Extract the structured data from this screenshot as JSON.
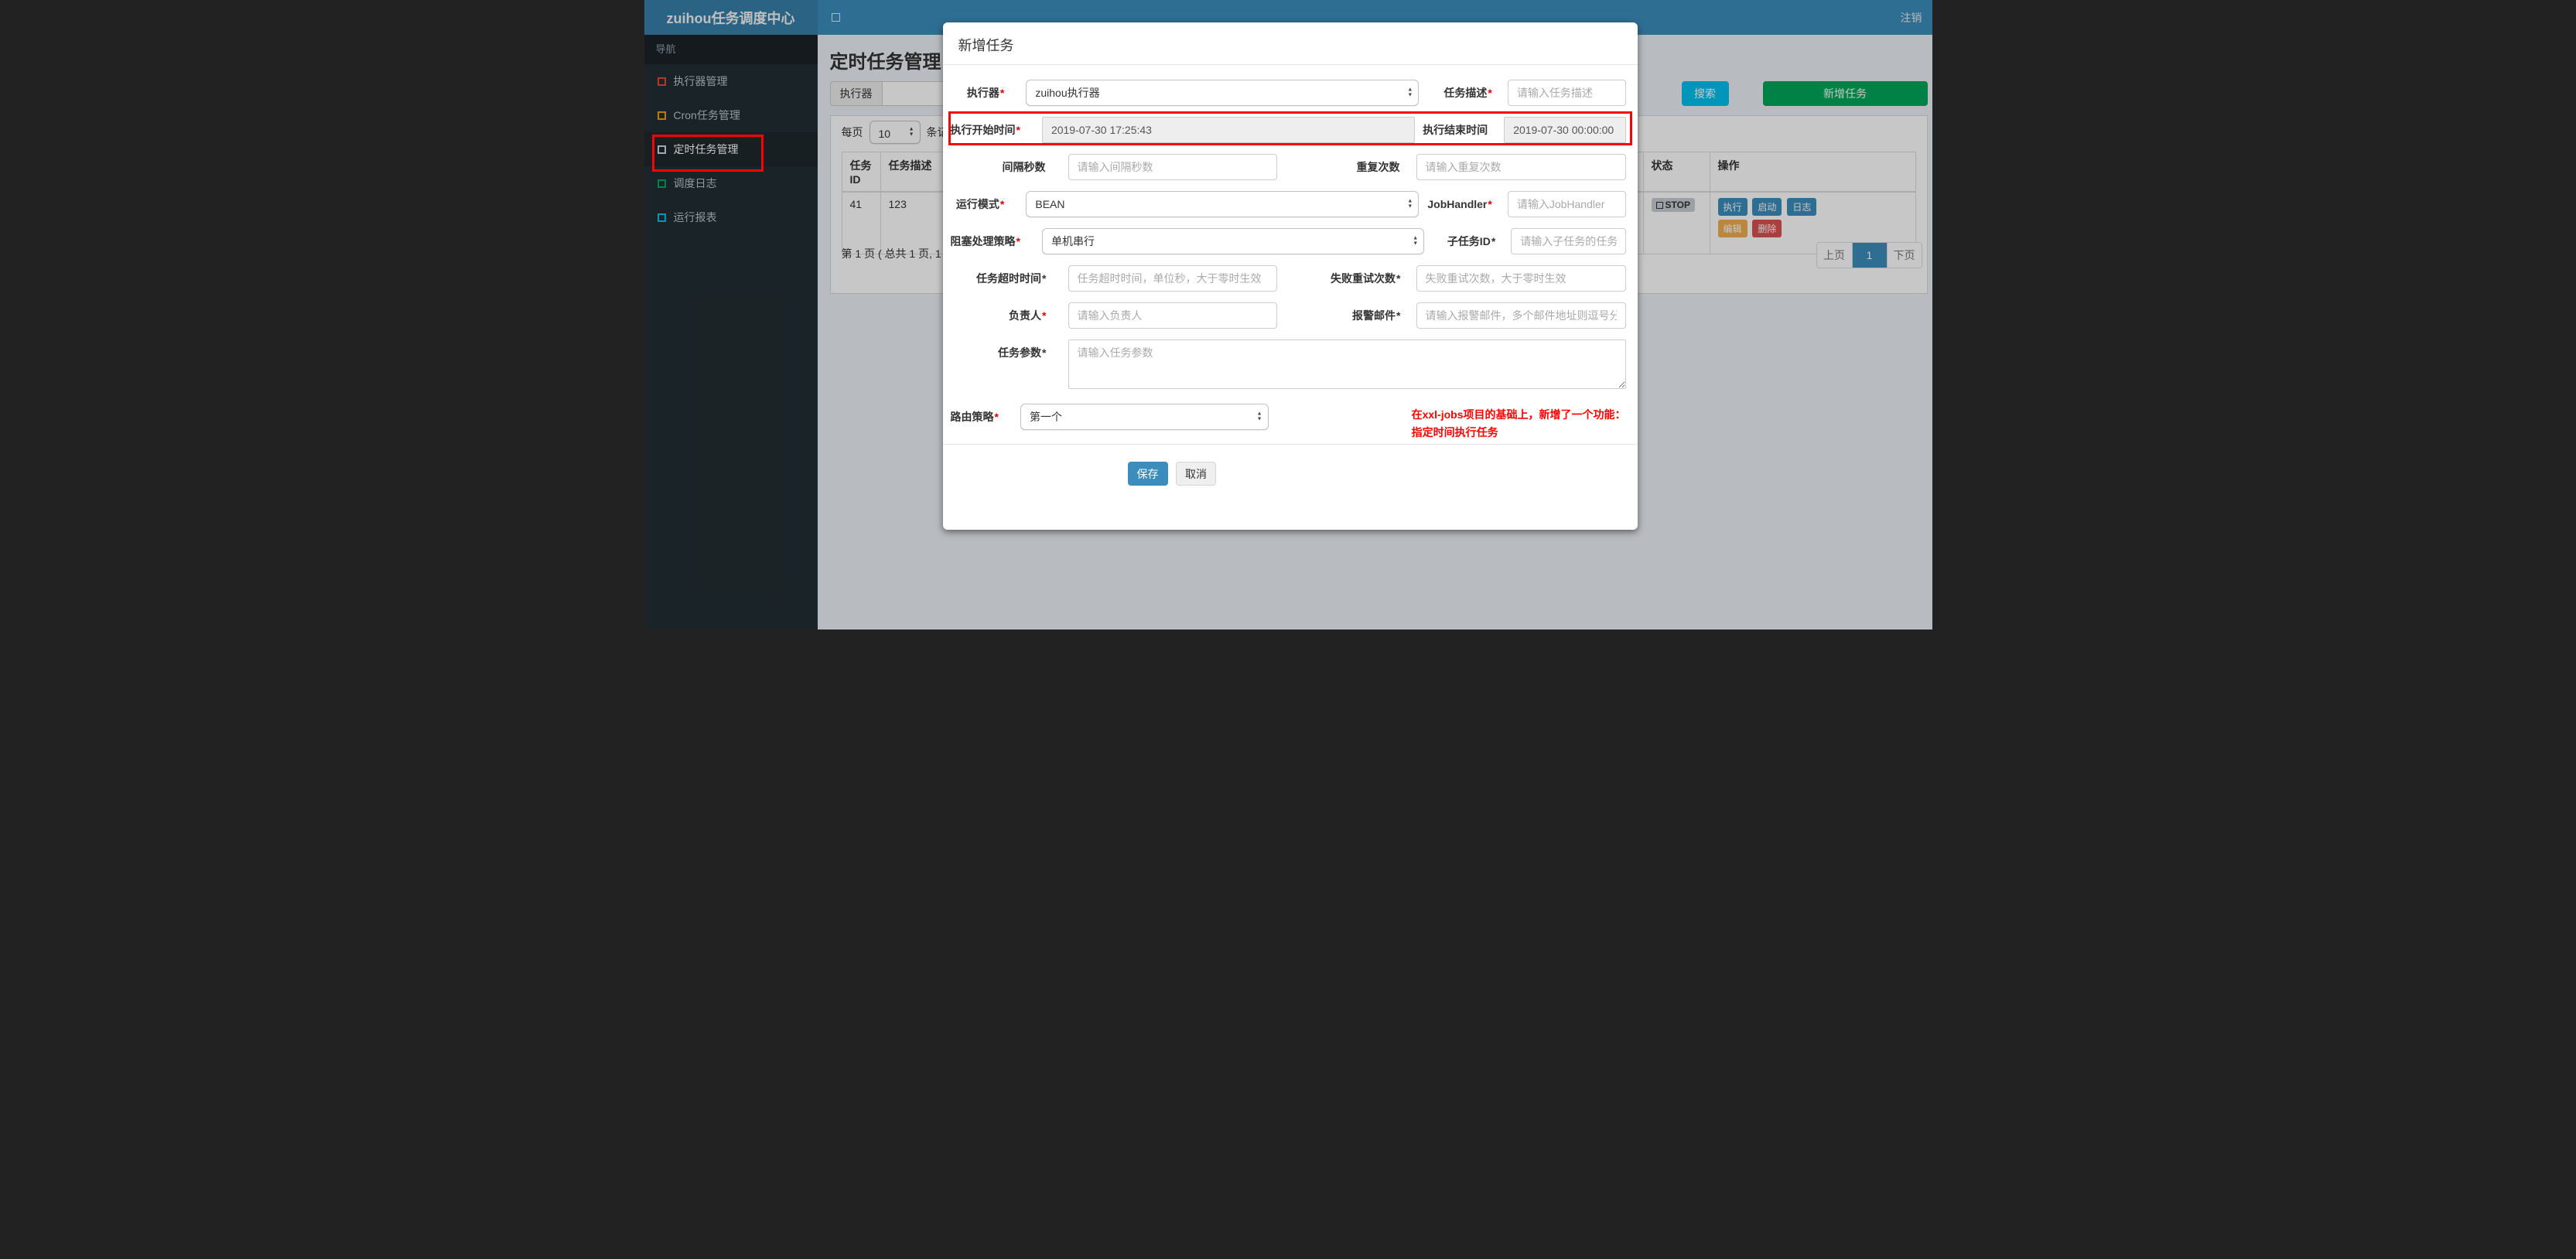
{
  "annotation_color": "#ff0000",
  "header": {
    "brand": "zuihou任务调度中心",
    "logout": "注销"
  },
  "sidebar": {
    "nav_label": "导航",
    "items": [
      {
        "label": "执行器管理",
        "color": "#dd4b39",
        "active": false
      },
      {
        "label": "Cron任务管理",
        "color": "#f39c12",
        "active": false
      },
      {
        "label": "定时任务管理",
        "color": "#d2d6de",
        "active": true
      },
      {
        "label": "调度日志",
        "color": "#00a65a",
        "active": false
      },
      {
        "label": "运行报表",
        "color": "#00c0ef",
        "active": false
      }
    ]
  },
  "content": {
    "page_title": "定时任务管理",
    "filter": {
      "executor_label": "执行器"
    },
    "buttons": {
      "search": "搜索",
      "search_color": "#00c0ef",
      "add": "新增任务",
      "add_color": "#00a65a"
    },
    "per_page": {
      "prefix": "每页",
      "value": "10",
      "suffix": "条记录"
    },
    "table": {
      "headers": {
        "job_id": "任务ID",
        "job_desc": "任务描述",
        "status": "状态",
        "actions": "操作"
      },
      "row": {
        "job_id": "41",
        "job_desc": "123",
        "status": "STOP",
        "actions": [
          {
            "label": "执行",
            "color": "#3c8dbc"
          },
          {
            "label": "启动",
            "color": "#3c8dbc"
          },
          {
            "label": "日志",
            "color": "#3c8dbc"
          },
          {
            "label": "编辑",
            "color": "#f0ad4e"
          },
          {
            "label": "删除",
            "color": "#d9534f"
          }
        ]
      }
    },
    "pagination": {
      "info": "第 1 页 ( 总共 1 页, 1",
      "prev": "上页",
      "current": "1",
      "next": "下页"
    }
  },
  "modal": {
    "title": "新增任务",
    "fields": [
      {
        "label": "执行器",
        "star": "*",
        "value": "zuihou执行器"
      },
      {
        "label": "任务描述",
        "star": "*",
        "placeholder": "请输入任务描述"
      },
      {
        "label": "执行开始时间",
        "star": "*",
        "value": "2019-07-30 17:25:43"
      },
      {
        "label": "执行结束时间",
        "star": "",
        "value": "2019-07-30 00:00:00"
      },
      {
        "label": "间隔秒数",
        "star": "",
        "placeholder": "请输入间隔秒数"
      },
      {
        "label": "重复次数",
        "star": "",
        "placeholder": "请输入重复次数"
      },
      {
        "label": "运行模式",
        "star": "*",
        "value": "BEAN"
      },
      {
        "label": "JobHandler",
        "star": "*",
        "placeholder": "请输入JobHandler"
      },
      {
        "label": "阻塞处理策略",
        "star": "*",
        "value": "单机串行"
      },
      {
        "label": "子任务ID",
        "star": "*",
        "placeholder": "请输入子任务的任务ID,如存在多个则逗号分隔"
      },
      {
        "label": "任务超时时间",
        "star": "*",
        "placeholder": "任务超时时间，单位秒，大于零时生效"
      },
      {
        "label": "失败重试次数",
        "star": "*",
        "placeholder": "失败重试次数，大于零时生效"
      },
      {
        "label": "负责人",
        "star": "*",
        "placeholder": "请输入负责人"
      },
      {
        "label": "报警邮件",
        "star": "*",
        "placeholder": "请输入报警邮件，多个邮件地址则逗号分隔"
      },
      {
        "label": "任务参数",
        "star": "*",
        "placeholder": "请输入任务参数"
      },
      {
        "label": "路由策略",
        "star": "*",
        "value": "第一个"
      }
    ],
    "note_line1": "在xxl-jobs项目的基础上，新增了一个功能：",
    "note_line2": "指定时间执行任务",
    "footer": {
      "save": "保存",
      "cancel": "取消"
    }
  }
}
